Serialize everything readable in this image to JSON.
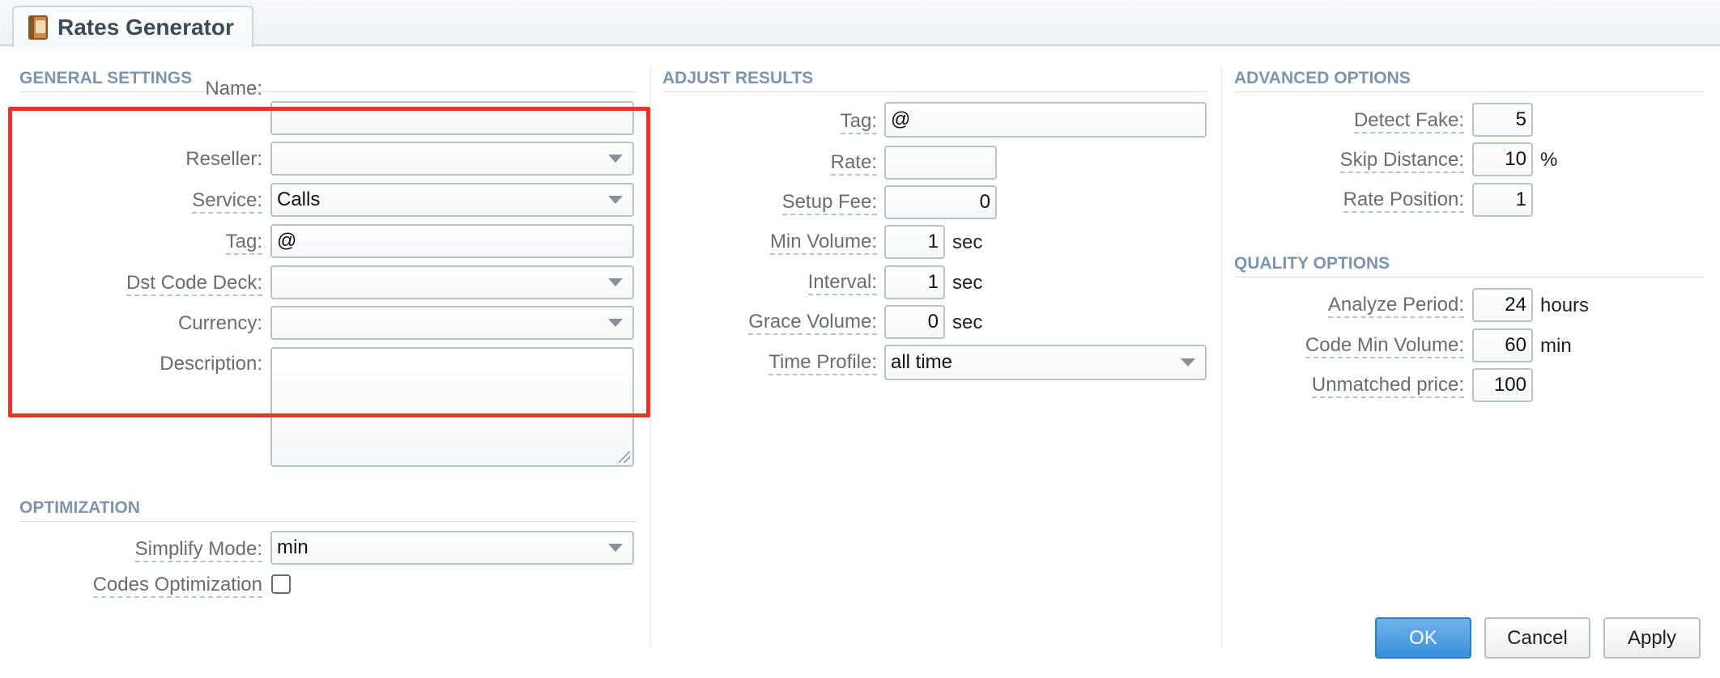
{
  "window": {
    "title": "Rates Generator",
    "icon": "rates-book-icon"
  },
  "general": {
    "title": "GENERAL SETTINGS",
    "name_label": "Name:",
    "name_value": "",
    "reseller_label": "Reseller:",
    "reseller_value": "",
    "service_label": "Service:",
    "service_value": "Calls",
    "tag_label": "Tag:",
    "tag_value": "@",
    "dst_label": "Dst Code Deck:",
    "dst_value": "",
    "currency_label": "Currency:",
    "currency_value": "",
    "description_label": "Description:",
    "description_value": ""
  },
  "optimization": {
    "title": "OPTIMIZATION",
    "simplify_label": "Simplify Mode:",
    "simplify_value": "min",
    "codes_label": "Codes Optimization",
    "codes_checked": false
  },
  "adjust": {
    "title": "ADJUST RESULTS",
    "tag_label": "Tag:",
    "tag_value": "@",
    "rate_label": "Rate:",
    "rate_value": "",
    "setup_label": "Setup Fee:",
    "setup_value": "0",
    "minvol_label": "Min Volume:",
    "minvol_value": "1",
    "minvol_unit": "sec",
    "interval_label": "Interval:",
    "interval_value": "1",
    "interval_unit": "sec",
    "grace_label": "Grace Volume:",
    "grace_value": "0",
    "grace_unit": "sec",
    "timeprofile_label": "Time Profile:",
    "timeprofile_value": "all time"
  },
  "advanced": {
    "title": "ADVANCED OPTIONS",
    "detect_label": "Detect Fake:",
    "detect_value": "5",
    "skip_label": "Skip Distance:",
    "skip_value": "10",
    "skip_unit": "%",
    "position_label": "Rate Position:",
    "position_value": "1"
  },
  "quality": {
    "title": "QUALITY OPTIONS",
    "analyze_label": "Analyze Period:",
    "analyze_value": "24",
    "analyze_unit": "hours",
    "codemin_label": "Code Min Volume:",
    "codemin_value": "60",
    "codemin_unit": "min",
    "unmatched_label": "Unmatched price:",
    "unmatched_value": "100"
  },
  "buttons": {
    "ok": "OK",
    "cancel": "Cancel",
    "apply": "Apply"
  },
  "colors": {
    "highlight": "#e3372b",
    "section_title": "#7d94ad",
    "primary": "#3a8fd8"
  }
}
